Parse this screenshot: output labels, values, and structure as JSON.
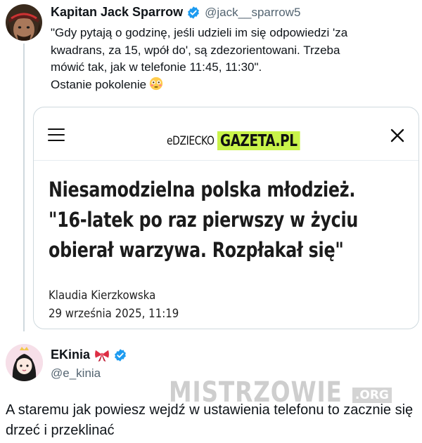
{
  "tweet1": {
    "display_name": "Kapitan Jack Sparrow",
    "handle": "@jack__sparrow5",
    "text": "\"Gdy pytają o godzinę, jeśli udzieli im się odpowiedzi 'za\nkwadrans, za 15, wpół do', są zdezorientowani. Trzeba\nmówić tak, jak w telefonie 11:45, 11:30\".\nOstanie pokolenie",
    "emoji": "flushed-face-emoji",
    "card": {
      "logo_left": "eDZIECKO",
      "logo_right": "GAZETA.PL",
      "logo_accent": "#c9f34a",
      "headline": "Niesamodzielna polska młodzież.\n\"16-latek po raz pierwszy w życiu\nobierał warzywa. Rozpłakał się\"",
      "author": "Klaudia Kierzkowska",
      "date": "29 września 2025, 11:19",
      "menu_icon": "hamburger-menu-icon",
      "close_icon": "close-icon"
    }
  },
  "tweet2": {
    "display_name": "EKinia",
    "handle": "@e_kinia",
    "bow_icon": "ribbon-bow-icon",
    "text": "A staremu jak powiesz wejdź w ustawienia telefonu to zacznie się drzeć i przeklinać"
  },
  "watermark": {
    "main": "MISTRZOWIE",
    "org": ".ORG"
  },
  "colors": {
    "verified": "#1d9bf0",
    "secondary_text": "#536471",
    "thread_line": "#cfd9de"
  }
}
